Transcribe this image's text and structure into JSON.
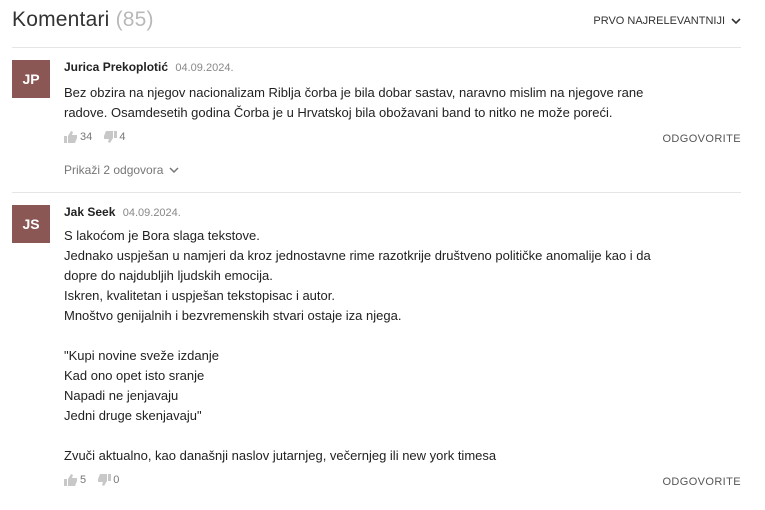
{
  "header": {
    "title": "Komentari",
    "count": "(85)",
    "sort_label": "PRVO NAJRELEVANTNIJI"
  },
  "comments": [
    {
      "initials": "JP",
      "author": "Jurica Prekoplotić",
      "date": "04.09.2024.",
      "lines": [
        "Bez obzira na njegov nacionalizam Riblja čorba je bila dobar sastav, naravno mislim na njegove rane",
        "radove. Osamdesetih godina Čorba je u Hrvatskoj bila obožavani band to nitko ne može poreći."
      ],
      "likes": "34",
      "dislikes": "4",
      "reply_label": "ODGOVORITE",
      "show_replies": "Prikaži 2 odgovora"
    },
    {
      "initials": "JS",
      "author": "Jak Seek",
      "date": "04.09.2024.",
      "lines": [
        "S lakoćom je Bora slaga tekstove.",
        "Jednako uspješan u namjeri da kroz jednostavne rime razotkrije društveno političke anomalije kao i da",
        "dopre do najdubljih ljudskih emocija.",
        "Iskren, kvalitetan i uspješan tekstopisac i autor.",
        "Mnoštvo genijalnih i bezvremenskih stvari ostaje iza njega.",
        "",
        "\"Kupi novine sveže izdanje",
        "Kad ono opet isto sranje",
        "Napadi ne jenjavaju",
        "Jedni druge skenjavaju\"",
        "",
        "Zvuči aktualno, kao današnji naslov jutarnjeg, večernjeg ili new york timesa"
      ],
      "likes": "5",
      "dislikes": "0",
      "reply_label": "ODGOVORITE"
    }
  ],
  "colors": {
    "avatar_bg": "#8b5755",
    "count_color": "#b9b9b9"
  },
  "icons": {
    "like": "thumbs-up-icon",
    "dislike": "thumbs-down-icon",
    "chevron": "chevron-down-icon"
  }
}
